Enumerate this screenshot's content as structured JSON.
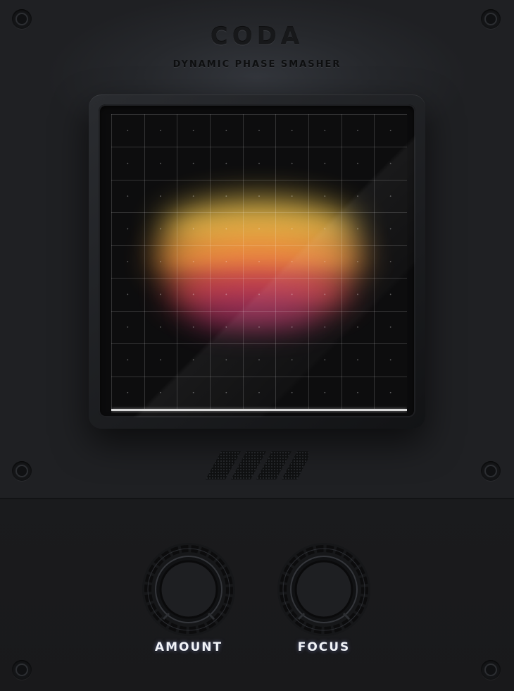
{
  "plugin": {
    "title": "CODA",
    "subtitle": "DYNAMIC PHASE SMASHER"
  },
  "display": {
    "grid_columns": 9,
    "grid_rows": 9,
    "spectrum_colors": [
      "#f3d45a",
      "#f6b04a",
      "#f48a3c",
      "#e0504e",
      "#b8306a"
    ]
  },
  "controls": {
    "amount": {
      "label": "AMOUNT"
    },
    "focus": {
      "label": "FOCUS"
    }
  },
  "icons": {
    "screw": "screw-icon",
    "vent": "vent-grille-icon"
  }
}
